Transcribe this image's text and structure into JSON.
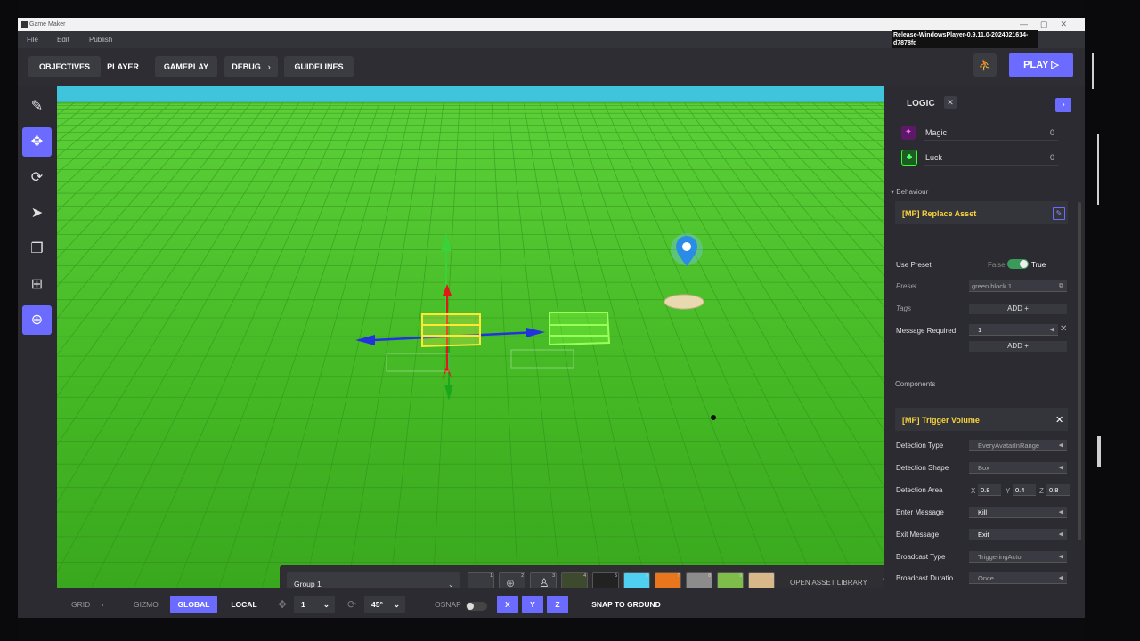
{
  "window": {
    "title": "Game Maker",
    "release": "Release-WindowsPlayer-0.9.11.0-2024021614-d7878fd"
  },
  "menu": [
    "File",
    "Edit",
    "Publish"
  ],
  "top_tabs": [
    {
      "label": "OBJECTIVES"
    },
    {
      "label": "PLAYER"
    },
    {
      "label": "GAMEPLAY"
    },
    {
      "label": "DEBUG",
      "chevron": "›"
    },
    {
      "label": "GUIDELINES"
    }
  ],
  "play_label": "PLAY",
  "play_icon": "▷",
  "accent_color": "#6b6bff",
  "tools": [
    {
      "name": "brush-icon",
      "glyph": "✎"
    },
    {
      "name": "move-icon",
      "glyph": "✥"
    },
    {
      "name": "rotate-icon",
      "glyph": "⟳"
    },
    {
      "name": "select-cursor-icon",
      "glyph": "➤"
    },
    {
      "name": "duplicate-icon",
      "glyph": "❐"
    },
    {
      "name": "transform-icon",
      "glyph": "⊞"
    },
    {
      "name": "add-object-icon",
      "glyph": "⊕"
    }
  ],
  "panel": {
    "title": "LOGIC",
    "stats": [
      {
        "label": "Magic",
        "value": "0",
        "icon": "magic-icon"
      },
      {
        "label": "Luck",
        "value": "0",
        "icon": "clover-icon"
      }
    ],
    "behaviour_header": "Behaviour",
    "behaviour": {
      "title": "[MP] Replace Asset",
      "use_preset_label": "Use Preset",
      "toggle_false": "False",
      "toggle_true": "True",
      "preset_label": "Preset",
      "preset_value": "green block 1",
      "tags_label": "Tags",
      "add_label": "ADD +",
      "message_required_label": "Message Required",
      "message_required_value": "1"
    },
    "components_header": "Components",
    "component": {
      "title": "[MP] Trigger Volume",
      "rows": [
        {
          "label": "Detection Type",
          "value": "EveryAvatarInRange"
        },
        {
          "label": "Detection Shape",
          "value": "Box"
        },
        {
          "label": "Enter Message",
          "value": "Kill"
        },
        {
          "label": "Exit Message",
          "value": "Exit"
        },
        {
          "label": "Broadcast Type",
          "value": "TriggeringActor"
        },
        {
          "label": "Broadcast Duratio...",
          "value": "Once"
        }
      ],
      "detection_area_label": "Detection Area",
      "detection_area": {
        "x": "0.8",
        "y": "0.4",
        "z": "0.8"
      }
    }
  },
  "asset_bar": {
    "group": "Group 1",
    "open_library": "OPEN ASSET LIBRARY",
    "slots": [
      "1",
      "2",
      "3",
      "4",
      "5",
      "6",
      "7",
      "8",
      "9",
      "0"
    ]
  },
  "bottom": {
    "grid": "GRID",
    "gizmo": "GIZMO",
    "global": "GLOBAL",
    "local": "LOCAL",
    "step": "1",
    "angle": "45°",
    "osnap": "OSNAP",
    "x": "X",
    "y": "Y",
    "z": "Z",
    "snap": "SNAP TO GROUND"
  }
}
